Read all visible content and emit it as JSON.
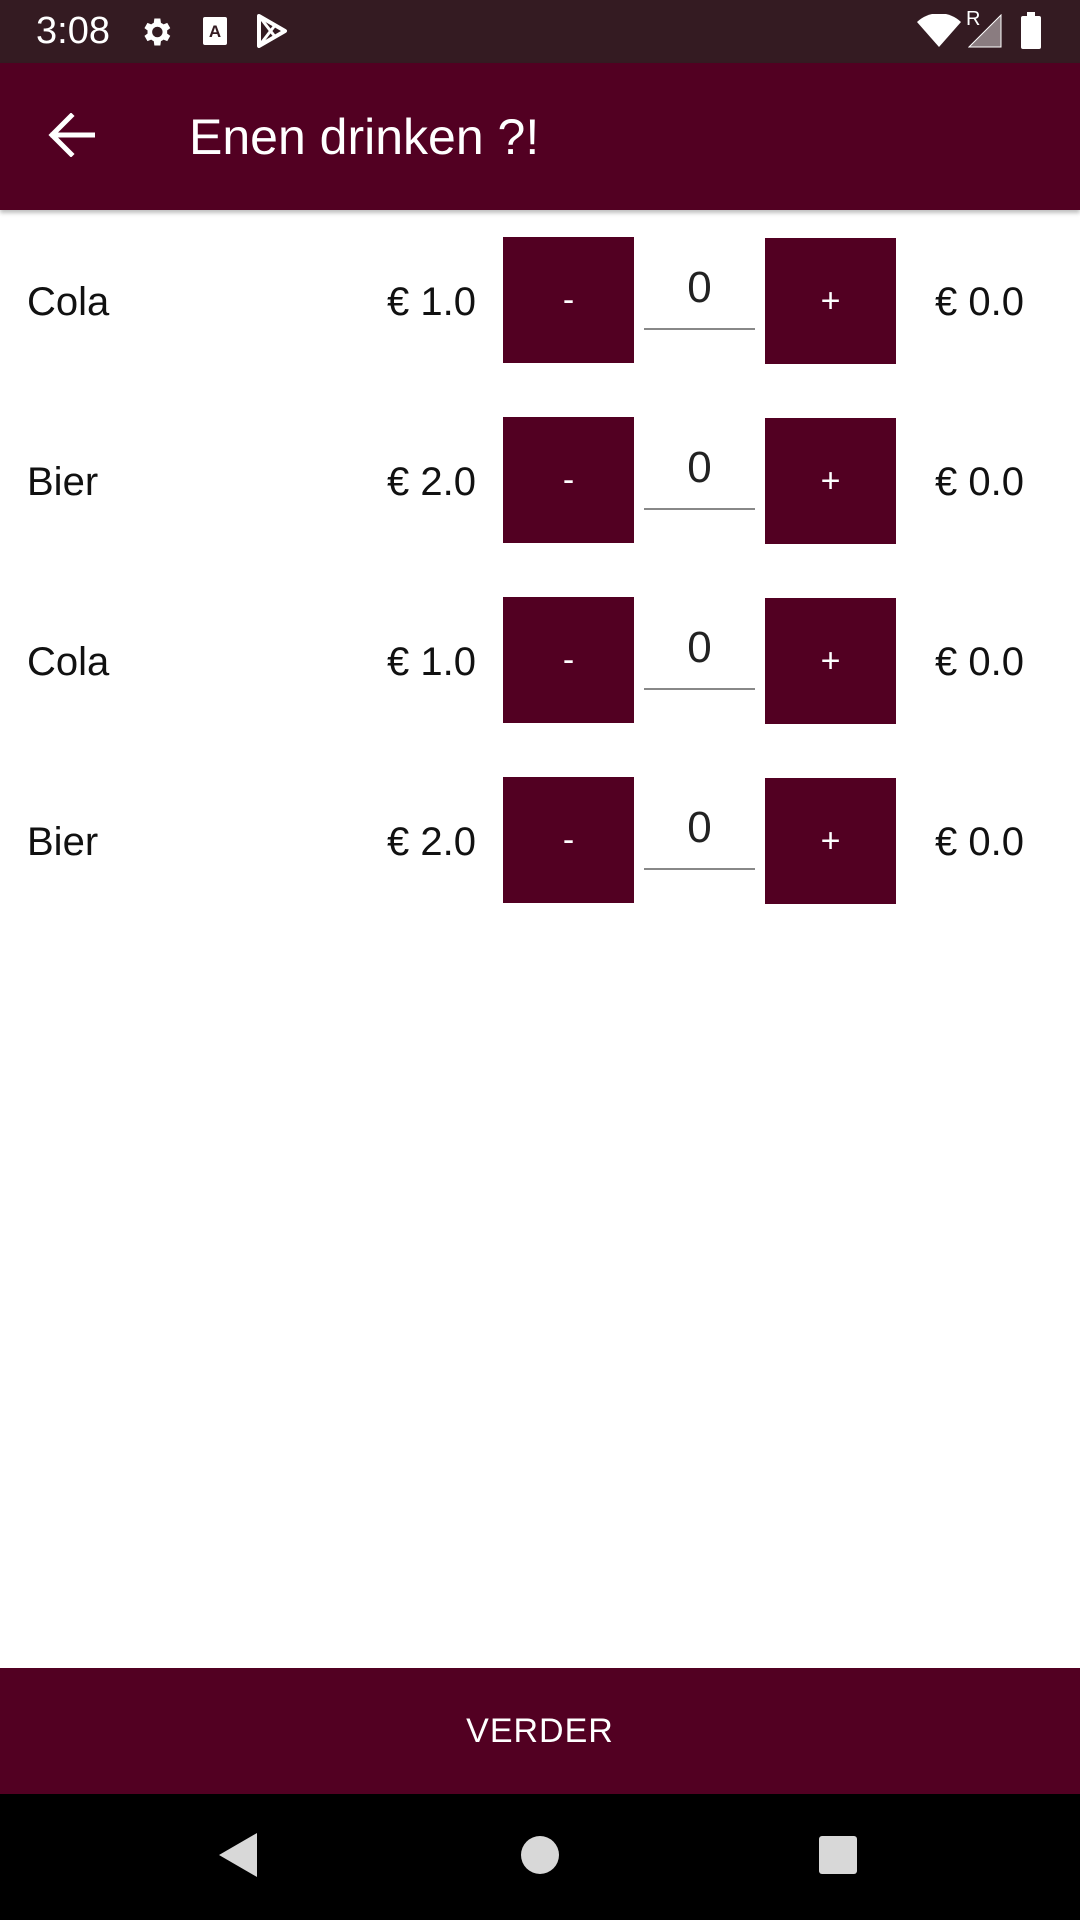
{
  "status_bar": {
    "time": "3:08",
    "icons": [
      "settings-icon",
      "font-a-icon",
      "play-store-icon",
      "wifi-icon",
      "signal-icon",
      "battery-icon"
    ],
    "roaming_label": "R"
  },
  "app_bar": {
    "title": "Enen drinken ?!",
    "back_icon": "arrow-back-icon"
  },
  "drinks": [
    {
      "name": "Cola",
      "price": "€ 1.0",
      "minus_label": "-",
      "quantity": "0",
      "plus_label": "+",
      "total": "€ 0.0"
    },
    {
      "name": "Bier",
      "price": "€ 2.0",
      "minus_label": "-",
      "quantity": "0",
      "plus_label": "+",
      "total": "€ 0.0"
    },
    {
      "name": "Cola",
      "price": "€ 1.0",
      "minus_label": "-",
      "quantity": "0",
      "plus_label": "+",
      "total": "€ 0.0"
    },
    {
      "name": "Bier",
      "price": "€ 2.0",
      "minus_label": "-",
      "quantity": "0",
      "plus_label": "+",
      "total": "€ 0.0"
    }
  ],
  "continue_label": "VERDER",
  "nav_bar": {
    "icons": [
      "nav-back-icon",
      "nav-home-icon",
      "nav-recents-icon"
    ]
  },
  "colors": {
    "primary": "#520022",
    "status_bar": "#341b22",
    "background": "#ffffff",
    "nav_bar": "#000000"
  }
}
